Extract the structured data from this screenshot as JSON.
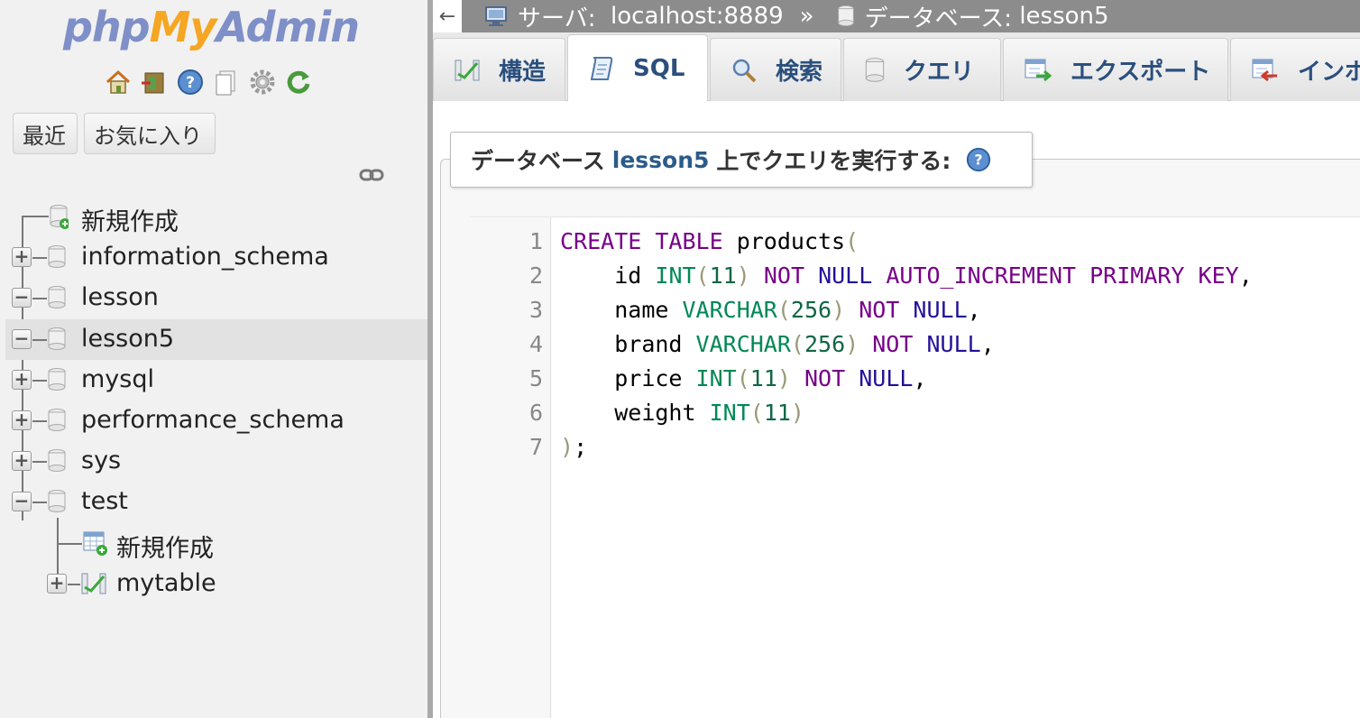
{
  "logo": {
    "php": "php",
    "my": "My",
    "admin": "Admin"
  },
  "nav": {
    "recent_label": "最近",
    "favorites_label": "お気に入り",
    "tree": [
      {
        "label": "新規作成",
        "type": "new"
      },
      {
        "label": "information_schema",
        "type": "db",
        "expander": "+"
      },
      {
        "label": "lesson",
        "type": "db",
        "expander": "−"
      },
      {
        "label": "lesson5",
        "type": "db",
        "expander": "−",
        "selected": true
      },
      {
        "label": "mysql",
        "type": "db",
        "expander": "+"
      },
      {
        "label": "performance_schema",
        "type": "db",
        "expander": "+"
      },
      {
        "label": "sys",
        "type": "db",
        "expander": "+"
      },
      {
        "label": "test",
        "type": "db",
        "expander": "−"
      },
      {
        "label": "新規作成",
        "type": "new-table",
        "child": true
      },
      {
        "label": "mytable",
        "type": "table",
        "child": true,
        "expander": "+"
      }
    ]
  },
  "breadcrumb": {
    "back": "←",
    "server_label": "サーバ:",
    "server_value": "localhost:8889",
    "separator": "»",
    "db_label": "データベース:",
    "db_value": "lesson5"
  },
  "tabs": [
    {
      "label": "構造",
      "icon": "structure-icon"
    },
    {
      "label": "SQL",
      "icon": "sql-icon",
      "active": true
    },
    {
      "label": "検索",
      "icon": "search-icon"
    },
    {
      "label": "クエリ",
      "icon": "query-icon"
    },
    {
      "label": "エクスポート",
      "icon": "export-icon"
    },
    {
      "label": "インポ",
      "icon": "import-icon"
    }
  ],
  "query_panel": {
    "prefix": "データベース",
    "db": "lesson5",
    "suffix": "上でクエリを実行する:"
  },
  "editor": {
    "line_numbers": [
      "1",
      "2",
      "3",
      "4",
      "5",
      "6",
      "7"
    ],
    "lines": [
      "CREATE TABLE products(",
      "    id INT(11) NOT NULL AUTO_INCREMENT PRIMARY KEY,",
      "    name VARCHAR(256) NOT NULL,",
      "    brand VARCHAR(256) NOT NULL,",
      "    price INT(11) NOT NULL,",
      "    weight INT(11)",
      ");"
    ]
  },
  "colors": {
    "keyword": "#770088",
    "type": "#008855",
    "null": "#221199",
    "accent": "#2b5b8a"
  }
}
